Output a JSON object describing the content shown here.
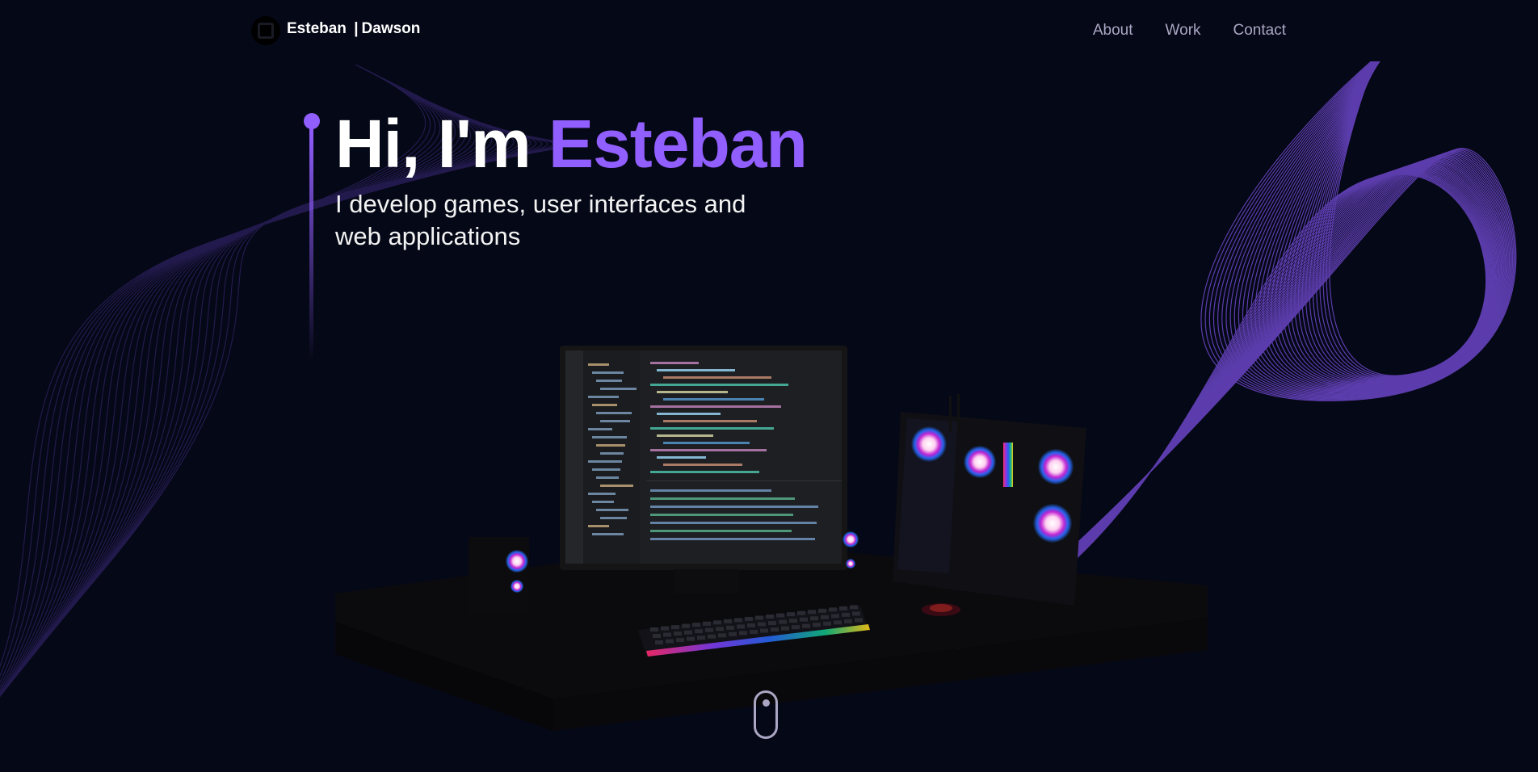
{
  "nav": {
    "brand_first": "Esteban",
    "brand_sep": "|",
    "brand_last": "Dawson",
    "links": [
      {
        "label": "About"
      },
      {
        "label": "Work"
      },
      {
        "label": "Contact"
      }
    ]
  },
  "hero": {
    "greeting": "Hi, I'm",
    "name": "Esteban",
    "subtitle": "I develop games, user interfaces and web applications"
  },
  "colors": {
    "background": "#050816",
    "accent": "#915eff",
    "nav_text": "#aaa6c3",
    "white": "#ffffff"
  },
  "icons": {
    "logo": "logo-icon",
    "scroll": "mouse-scroll-icon"
  }
}
